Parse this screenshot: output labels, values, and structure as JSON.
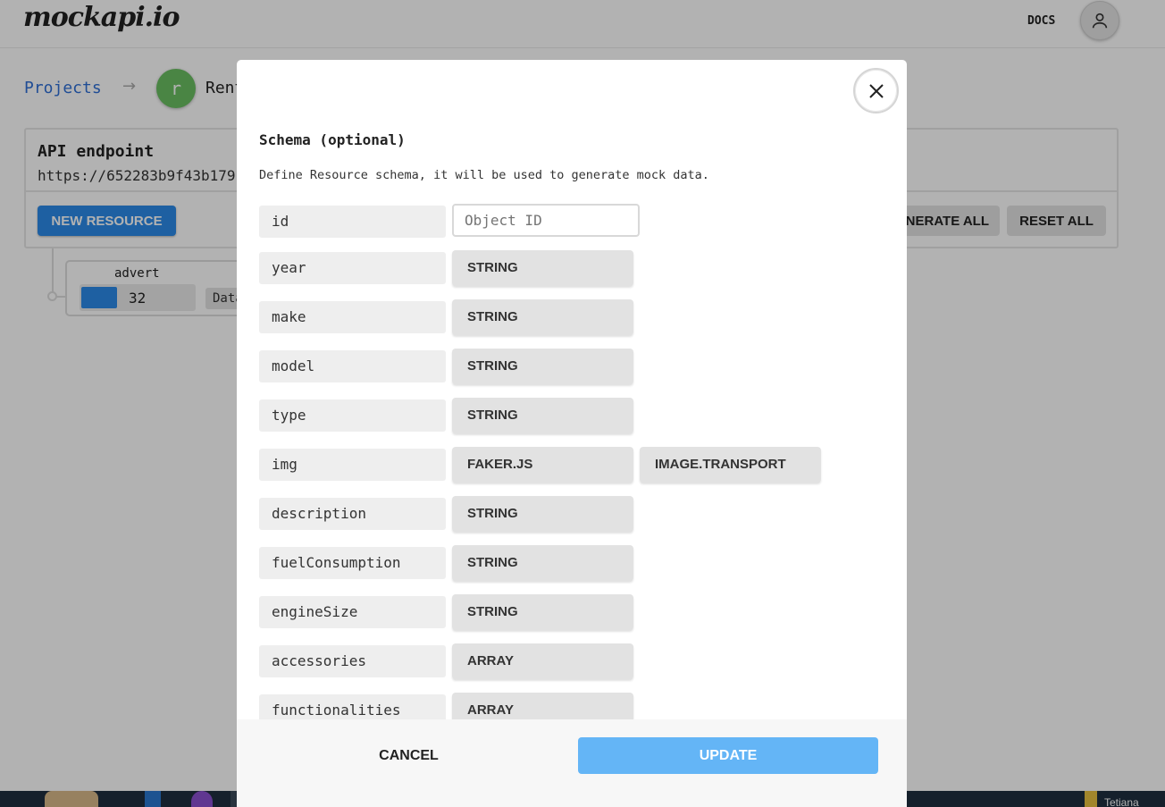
{
  "header": {
    "logo": "mockapi.io",
    "docs_label": "DOCS",
    "avatar_icon": "user-icon"
  },
  "breadcrumb": {
    "projects_label": "Projects",
    "arrow": "→",
    "project_initial": "r",
    "project_name": "Rent"
  },
  "api": {
    "title": "API endpoint",
    "url": "https://652283b9f43b179",
    "new_resource_label": "NEW RESOURCE",
    "generate_all_label": "NERATE ALL",
    "reset_all_label": "RESET ALL"
  },
  "resource": {
    "name": "advert",
    "count": "32",
    "data_label": "Data"
  },
  "modal": {
    "title": "Schema (optional)",
    "description": "Define Resource schema, it will be used to generate mock data.",
    "rows": [
      {
        "name": "id",
        "placeholder": "Object ID"
      },
      {
        "name": "year",
        "type": "STRING"
      },
      {
        "name": "make",
        "type": "STRING"
      },
      {
        "name": "model",
        "type": "STRING"
      },
      {
        "name": "type",
        "type": "STRING"
      },
      {
        "name": "img",
        "type": "FAKER.JS",
        "subtype": "IMAGE.TRANSPORT"
      },
      {
        "name": "description",
        "type": "STRING"
      },
      {
        "name": "fuelConsumption",
        "type": "STRING"
      },
      {
        "name": "engineSize",
        "type": "STRING"
      },
      {
        "name": "accessories",
        "type": "ARRAY"
      },
      {
        "name": "functionalities",
        "type": "ARRAY"
      }
    ],
    "cancel_label": "CANCEL",
    "update_label": "UPDATE",
    "close_icon": "close-icon"
  },
  "taskbar": {
    "user_label": "Tetiana"
  },
  "colors": {
    "primary": "#2b8ae8",
    "update": "#64b5f6",
    "avatar": "#6bbf62",
    "link": "#2f6fd6"
  }
}
